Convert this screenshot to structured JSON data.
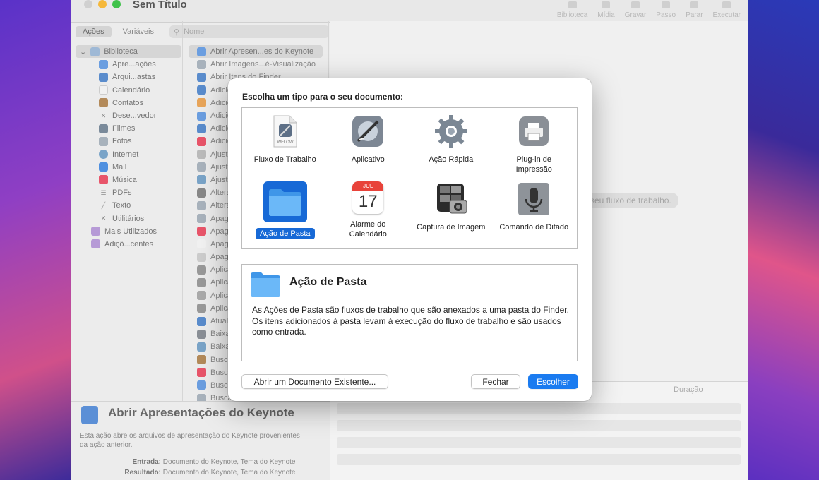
{
  "window": {
    "title": "Sem Título"
  },
  "toolbar": [
    "Biblioteca",
    "Mídia",
    "Gravar",
    "Passo",
    "Parar",
    "Executar"
  ],
  "tabs": {
    "actions": "Ações",
    "variables": "Variáveis",
    "search_placeholder": "Nome"
  },
  "library": {
    "root": "Biblioteca",
    "children": [
      "Apre...ações",
      "Arqui...astas",
      "Calendário",
      "Contatos",
      "Dese...vedor",
      "Filmes",
      "Fotos",
      "Internet",
      "Mail",
      "Música",
      "PDFs",
      "Texto",
      "Utilitários"
    ],
    "extra": [
      "Mais Utilizados",
      "Adiçõ...centes"
    ]
  },
  "actions": [
    "Abrir Apresen...es do Keynote",
    "Abrir Imagens...é-Visualização",
    "Abrir Itens do Finder",
    "Adicio",
    "Adicio",
    "Adicio",
    "Adicio",
    "Adicio",
    "Ajusta",
    "Ajusta",
    "Ajusta",
    "Altera",
    "Altera",
    "Apaga",
    "Apaga",
    "Apaga",
    "Apaga",
    "Aplica",
    "Aplica",
    "Aplica",
    "Aplica",
    "Atuali",
    "Baixa",
    "Baixa",
    "Busca",
    "Busca",
    "Busca",
    "Busca"
  ],
  "canvas": {
    "hint": "seu fluxo de trabalho."
  },
  "log": {
    "duration": "Duração"
  },
  "description": {
    "title": "Abrir Apresentações do Keynote",
    "text": "Esta ação abre os arquivos de apresentação do Keynote provenientes da ação anterior.",
    "input_label": "Entrada:",
    "input_value": "Documento do Keynote, Tema do Keynote",
    "result_label": "Resultado:",
    "result_value": "Documento do Keynote, Tema do Keynote"
  },
  "dialog": {
    "heading": "Escolha um tipo para o seu documento:",
    "types": [
      {
        "label": "Fluxo de Trabalho",
        "icon": "workflow-file-icon"
      },
      {
        "label": "Aplicativo",
        "icon": "automator-app-icon"
      },
      {
        "label": "Ação Rápida",
        "icon": "gear-icon"
      },
      {
        "label": "Plug-in de Impressão",
        "icon": "printer-icon"
      },
      {
        "label": "Ação de Pasta",
        "icon": "folder-icon",
        "selected": true
      },
      {
        "label": "Alarme do Calendário",
        "icon": "calendar-icon",
        "month": "JUL",
        "day": "17"
      },
      {
        "label": "Captura de Imagem",
        "icon": "image-capture-icon"
      },
      {
        "label": "Comando de Ditado",
        "icon": "microphone-icon"
      }
    ],
    "wflow_tag": "WFLOW",
    "selected_title": "Ação de Pasta",
    "selected_description": "As Ações de Pasta são fluxos de trabalho que são anexados a uma pasta do Finder. Os itens adicionados à pasta levam à execução do fluxo de trabalho e são usados como entrada.",
    "buttons": {
      "open_existing": "Abrir um Documento Existente...",
      "close": "Fechar",
      "choose": "Escolher"
    }
  },
  "colors": {
    "accent": "#1a7bf0",
    "selection": "#1769d6"
  }
}
